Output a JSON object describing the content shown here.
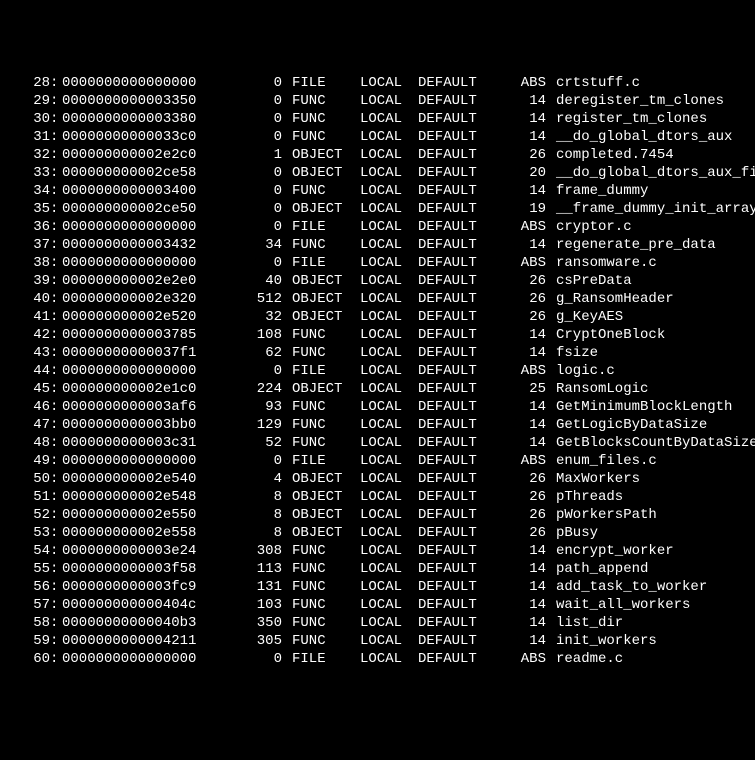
{
  "rows": [
    {
      "num": "28",
      "value": "0000000000000000",
      "size": "0",
      "type": "FILE",
      "bind": "LOCAL",
      "vis": "DEFAULT",
      "ndx": "ABS",
      "name": "crtstuff.c"
    },
    {
      "num": "29",
      "value": "0000000000003350",
      "size": "0",
      "type": "FUNC",
      "bind": "LOCAL",
      "vis": "DEFAULT",
      "ndx": "14",
      "name": "deregister_tm_clones"
    },
    {
      "num": "30",
      "value": "0000000000003380",
      "size": "0",
      "type": "FUNC",
      "bind": "LOCAL",
      "vis": "DEFAULT",
      "ndx": "14",
      "name": "register_tm_clones"
    },
    {
      "num": "31",
      "value": "00000000000033c0",
      "size": "0",
      "type": "FUNC",
      "bind": "LOCAL",
      "vis": "DEFAULT",
      "ndx": "14",
      "name": "__do_global_dtors_aux"
    },
    {
      "num": "32",
      "value": "000000000002e2c0",
      "size": "1",
      "type": "OBJECT",
      "bind": "LOCAL",
      "vis": "DEFAULT",
      "ndx": "26",
      "name": "completed.7454"
    },
    {
      "num": "33",
      "value": "000000000002ce58",
      "size": "0",
      "type": "OBJECT",
      "bind": "LOCAL",
      "vis": "DEFAULT",
      "ndx": "20",
      "name": "__do_global_dtors_aux_fin"
    },
    {
      "num": "34",
      "value": "0000000000003400",
      "size": "0",
      "type": "FUNC",
      "bind": "LOCAL",
      "vis": "DEFAULT",
      "ndx": "14",
      "name": "frame_dummy"
    },
    {
      "num": "35",
      "value": "000000000002ce50",
      "size": "0",
      "type": "OBJECT",
      "bind": "LOCAL",
      "vis": "DEFAULT",
      "ndx": "19",
      "name": "__frame_dummy_init_array_"
    },
    {
      "num": "36",
      "value": "0000000000000000",
      "size": "0",
      "type": "FILE",
      "bind": "LOCAL",
      "vis": "DEFAULT",
      "ndx": "ABS",
      "name": "cryptor.c"
    },
    {
      "num": "37",
      "value": "0000000000003432",
      "size": "34",
      "type": "FUNC",
      "bind": "LOCAL",
      "vis": "DEFAULT",
      "ndx": "14",
      "name": "regenerate_pre_data"
    },
    {
      "num": "38",
      "value": "0000000000000000",
      "size": "0",
      "type": "FILE",
      "bind": "LOCAL",
      "vis": "DEFAULT",
      "ndx": "ABS",
      "name": "ransomware.c"
    },
    {
      "num": "39",
      "value": "000000000002e2e0",
      "size": "40",
      "type": "OBJECT",
      "bind": "LOCAL",
      "vis": "DEFAULT",
      "ndx": "26",
      "name": "csPreData"
    },
    {
      "num": "40",
      "value": "000000000002e320",
      "size": "512",
      "type": "OBJECT",
      "bind": "LOCAL",
      "vis": "DEFAULT",
      "ndx": "26",
      "name": "g_RansomHeader"
    },
    {
      "num": "41",
      "value": "000000000002e520",
      "size": "32",
      "type": "OBJECT",
      "bind": "LOCAL",
      "vis": "DEFAULT",
      "ndx": "26",
      "name": "g_KeyAES"
    },
    {
      "num": "42",
      "value": "0000000000003785",
      "size": "108",
      "type": "FUNC",
      "bind": "LOCAL",
      "vis": "DEFAULT",
      "ndx": "14",
      "name": "CryptOneBlock"
    },
    {
      "num": "43",
      "value": "00000000000037f1",
      "size": "62",
      "type": "FUNC",
      "bind": "LOCAL",
      "vis": "DEFAULT",
      "ndx": "14",
      "name": "fsize"
    },
    {
      "num": "44",
      "value": "0000000000000000",
      "size": "0",
      "type": "FILE",
      "bind": "LOCAL",
      "vis": "DEFAULT",
      "ndx": "ABS",
      "name": "logic.c"
    },
    {
      "num": "45",
      "value": "000000000002e1c0",
      "size": "224",
      "type": "OBJECT",
      "bind": "LOCAL",
      "vis": "DEFAULT",
      "ndx": "25",
      "name": "RansomLogic"
    },
    {
      "num": "46",
      "value": "0000000000003af6",
      "size": "93",
      "type": "FUNC",
      "bind": "LOCAL",
      "vis": "DEFAULT",
      "ndx": "14",
      "name": "GetMinimumBlockLength"
    },
    {
      "num": "47",
      "value": "0000000000003bb0",
      "size": "129",
      "type": "FUNC",
      "bind": "LOCAL",
      "vis": "DEFAULT",
      "ndx": "14",
      "name": "GetLogicByDataSize"
    },
    {
      "num": "48",
      "value": "0000000000003c31",
      "size": "52",
      "type": "FUNC",
      "bind": "LOCAL",
      "vis": "DEFAULT",
      "ndx": "14",
      "name": "GetBlocksCountByDataSize"
    },
    {
      "num": "49",
      "value": "0000000000000000",
      "size": "0",
      "type": "FILE",
      "bind": "LOCAL",
      "vis": "DEFAULT",
      "ndx": "ABS",
      "name": "enum_files.c"
    },
    {
      "num": "50",
      "value": "000000000002e540",
      "size": "4",
      "type": "OBJECT",
      "bind": "LOCAL",
      "vis": "DEFAULT",
      "ndx": "26",
      "name": "MaxWorkers"
    },
    {
      "num": "51",
      "value": "000000000002e548",
      "size": "8",
      "type": "OBJECT",
      "bind": "LOCAL",
      "vis": "DEFAULT",
      "ndx": "26",
      "name": "pThreads"
    },
    {
      "num": "52",
      "value": "000000000002e550",
      "size": "8",
      "type": "OBJECT",
      "bind": "LOCAL",
      "vis": "DEFAULT",
      "ndx": "26",
      "name": "pWorkersPath"
    },
    {
      "num": "53",
      "value": "000000000002e558",
      "size": "8",
      "type": "OBJECT",
      "bind": "LOCAL",
      "vis": "DEFAULT",
      "ndx": "26",
      "name": "pBusy"
    },
    {
      "num": "54",
      "value": "0000000000003e24",
      "size": "308",
      "type": "FUNC",
      "bind": "LOCAL",
      "vis": "DEFAULT",
      "ndx": "14",
      "name": "encrypt_worker"
    },
    {
      "num": "55",
      "value": "0000000000003f58",
      "size": "113",
      "type": "FUNC",
      "bind": "LOCAL",
      "vis": "DEFAULT",
      "ndx": "14",
      "name": "path_append"
    },
    {
      "num": "56",
      "value": "0000000000003fc9",
      "size": "131",
      "type": "FUNC",
      "bind": "LOCAL",
      "vis": "DEFAULT",
      "ndx": "14",
      "name": "add_task_to_worker"
    },
    {
      "num": "57",
      "value": "000000000000404c",
      "size": "103",
      "type": "FUNC",
      "bind": "LOCAL",
      "vis": "DEFAULT",
      "ndx": "14",
      "name": "wait_all_workers"
    },
    {
      "num": "58",
      "value": "00000000000040b3",
      "size": "350",
      "type": "FUNC",
      "bind": "LOCAL",
      "vis": "DEFAULT",
      "ndx": "14",
      "name": "list_dir"
    },
    {
      "num": "59",
      "value": "0000000000004211",
      "size": "305",
      "type": "FUNC",
      "bind": "LOCAL",
      "vis": "DEFAULT",
      "ndx": "14",
      "name": "init_workers"
    },
    {
      "num": "60",
      "value": "0000000000000000",
      "size": "0",
      "type": "FILE",
      "bind": "LOCAL",
      "vis": "DEFAULT",
      "ndx": "ABS",
      "name": "readme.c"
    }
  ]
}
